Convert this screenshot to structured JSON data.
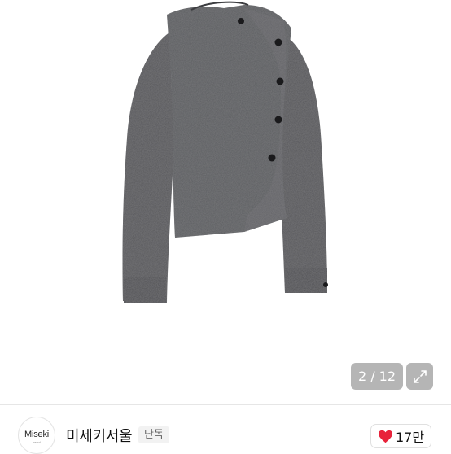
{
  "gallery": {
    "counter": "2 / 12",
    "image_subject": "grey knit asymmetric button cardigan"
  },
  "shop": {
    "avatar_text": "Miseki",
    "avatar_sub": "seoul",
    "name": "미세키서울",
    "badge": "단독",
    "likes": "17만"
  },
  "colors": {
    "heart": "#e8233b",
    "overlay": "#787878"
  }
}
